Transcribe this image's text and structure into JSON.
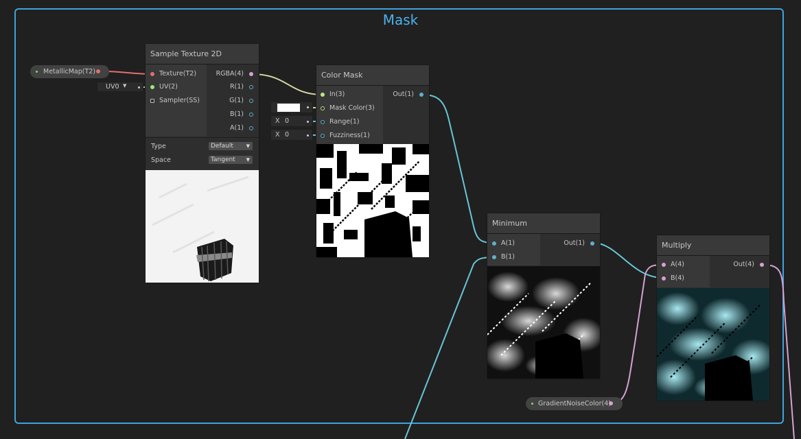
{
  "group": {
    "title": "Mask"
  },
  "colors": {
    "frame": "#3fa3dd",
    "wire_texture": "#e36f6f",
    "wire_vector3": "#c3e486",
    "wire_vector2": "#9be87b",
    "wire_float": "#67c6d6",
    "wire_vector4": "#d7a1d3"
  },
  "sample_texture": {
    "title": "Sample Texture 2D",
    "inputs": [
      "Texture(T2)",
      "UV(2)",
      "Sampler(SS)"
    ],
    "outputs": [
      "RGBA(4)",
      "R(1)",
      "G(1)",
      "B(1)",
      "A(1)"
    ],
    "type_label": "Type",
    "type_value": "Default",
    "space_label": "Space",
    "space_value": "Tangent"
  },
  "property_metallic": {
    "label": "MetallicMap(T2)"
  },
  "uv_dropdown": {
    "value": "UV0"
  },
  "color_mask": {
    "title": "Color Mask",
    "inputs": [
      "In(3)",
      "Mask Color(3)",
      "Range(1)",
      "Fuzziness(1)"
    ],
    "output": "Out(1)",
    "range_axis": "X",
    "range_value": "0",
    "fuzz_axis": "X",
    "fuzz_value": "0",
    "mask_color": "#ffffff"
  },
  "minimum": {
    "title": "Minimum",
    "inputs": [
      "A(1)",
      "B(1)"
    ],
    "output": "Out(1)"
  },
  "multiply": {
    "title": "Multiply",
    "inputs": [
      "A(4)",
      "B(4)"
    ],
    "output": "Out(4)"
  },
  "property_gradient": {
    "label": "GradientNoiseColor(4)"
  }
}
